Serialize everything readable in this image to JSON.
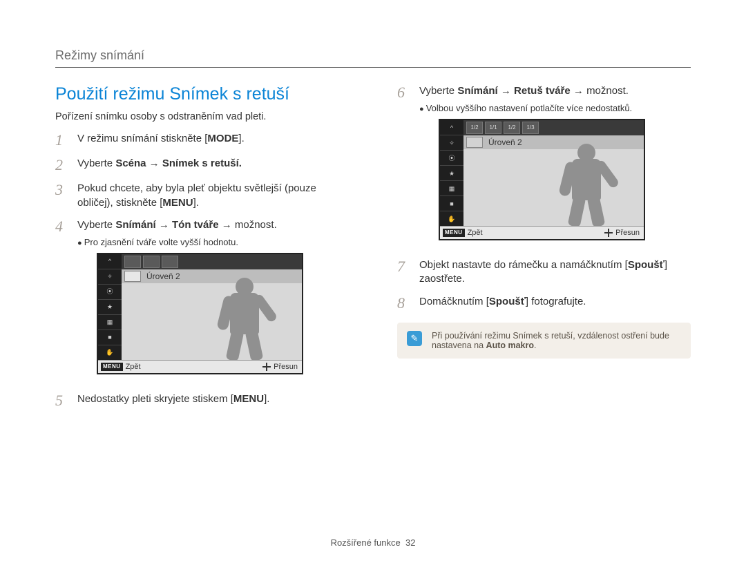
{
  "header": {
    "topic": "Režimy snímání"
  },
  "section": {
    "title": "Použití režimu Snímek s retuší",
    "intro": "Pořízení snímku osoby s odstraněním vad pleti."
  },
  "steps": {
    "1": {
      "num": "1",
      "pre": "V režimu snímání stiskněte [",
      "btn": "MODE",
      "post": "]."
    },
    "2": {
      "num": "2",
      "pre": "Vyberte ",
      "b1": "Scéna",
      "arrow": " → ",
      "b2": "Snímek s retuší",
      "post": "."
    },
    "3": {
      "num": "3",
      "pre": "Pokud chcete, aby byla pleť objektu světlejší (pouze obličej), stiskněte [",
      "btn": "MENU",
      "post": "]."
    },
    "4": {
      "num": "4",
      "pre": "Vyberte ",
      "b1": "Snímání",
      "arrow1": " → ",
      "b2": "Tón tváře",
      "arrow2": " → ",
      "tail": "možnost.",
      "bullet": "Pro zjasnění tváře volte vyšší hodnotu."
    },
    "5": {
      "num": "5",
      "pre": "Nedostatky pleti skryjete stiskem [",
      "btn": "MENU",
      "post": "]."
    },
    "6": {
      "num": "6",
      "pre": "Vyberte ",
      "b1": "Snímání",
      "arrow1": " → ",
      "b2": "Retuš tváře",
      "arrow2": " → ",
      "tail": "možnost.",
      "bullet": "Volbou vyššího nastavení potlačíte více nedostatků."
    },
    "7": {
      "num": "7",
      "pre": "Objekt nastavte do rámečku a namáčknutím [",
      "btn": "Spoušť",
      "post": "] zaostřete."
    },
    "8": {
      "num": "8",
      "pre": "Domáčknutím [",
      "btn": "Spoušť",
      "post": "] fotografujte."
    }
  },
  "camera": {
    "level_text": "Úroveň 2",
    "back": "Zpět",
    "move": "Přesun",
    "menu": "MENU",
    "top_icons": [
      "1/2",
      "1/1",
      "1/2",
      "1/3"
    ],
    "side_icons": [
      "^",
      "✧",
      "⦿",
      "★",
      "▦",
      "■",
      "✋"
    ]
  },
  "note": {
    "text_pre": "Při používání režimu Snímek s retuší, vzdálenost ostření bude nastavena na ",
    "text_bold": "Auto makro",
    "text_post": "."
  },
  "footer": {
    "section": "Rozšířené funkce",
    "page": "32"
  }
}
